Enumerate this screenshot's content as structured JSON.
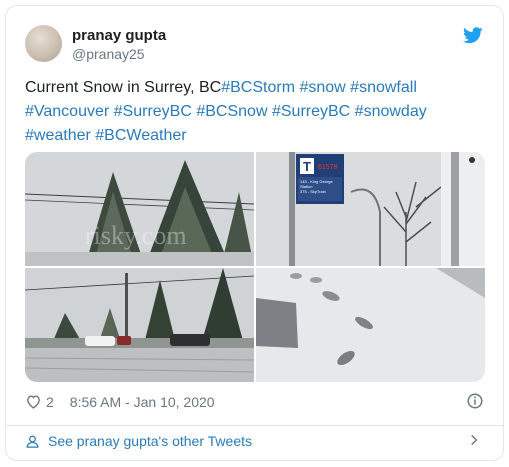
{
  "user": {
    "name": "pranay gupta",
    "handle": "@pranay25"
  },
  "tweet": {
    "text_lead": "Current Snow in Surrey, BC",
    "hashtags": [
      "#BCStorm",
      "#snow",
      "#snowfall",
      "#Vancouver",
      "#SurreyBC",
      "#BCSnow",
      "#SurreyBC",
      "#snowday",
      "#weather",
      "#BCWeather"
    ]
  },
  "photos": {
    "watermark": "risky.com",
    "bus_sign": {
      "route_no": "61578",
      "lines": [
        "145 - King George",
        "Station",
        "375 - SkyTrain"
      ]
    }
  },
  "meta": {
    "likes": "2",
    "timestamp": "8:56 AM - Jan 10, 2020"
  },
  "footer": {
    "link": "See pranay gupta's other Tweets"
  },
  "colors": {
    "link": "#2b7bb9",
    "twitter_blue": "#1da1f2",
    "muted": "#697882"
  },
  "icons": [
    "twitter-bird-icon",
    "heart-icon",
    "info-icon",
    "person-icon",
    "chevron-right-icon"
  ]
}
